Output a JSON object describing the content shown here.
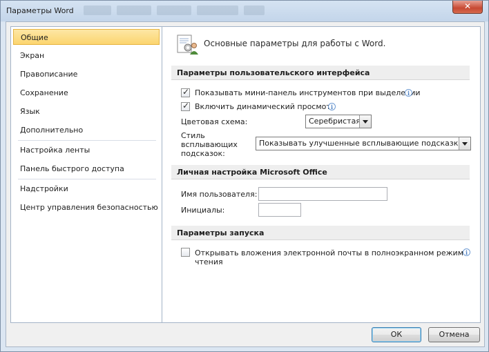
{
  "window": {
    "title": "Параметры Word",
    "close_label": "✕"
  },
  "sidebar": {
    "items": [
      {
        "label": "Общие"
      },
      {
        "label": "Экран"
      },
      {
        "label": "Правописание"
      },
      {
        "label": "Сохранение"
      },
      {
        "label": "Язык"
      },
      {
        "label": "Дополнительно"
      },
      {
        "label": "Настройка ленты"
      },
      {
        "label": "Панель быстрого доступа"
      },
      {
        "label": "Надстройки"
      },
      {
        "label": "Центр управления безопасностью"
      }
    ],
    "selected_index": 0
  },
  "content": {
    "header": "Основные параметры для работы с Word.",
    "ui_section": {
      "title": "Параметры пользовательского интерфейса",
      "mini_toolbar_label": "Показывать мини-панель инструментов при выделении",
      "mini_toolbar_checked": true,
      "live_preview_label": "Включить динамический просмотр",
      "live_preview_checked": true,
      "color_scheme_label": "Цветовая схема:",
      "color_scheme_value": "Серебристая",
      "tooltip_style_label_1": "Стиль",
      "tooltip_style_label_2": "всплывающих",
      "tooltip_style_label_3": "подсказок:",
      "tooltip_style_value": "Показывать улучшенные всплывающие подсказки"
    },
    "personal_section": {
      "title": "Личная настройка Microsoft Office",
      "username_label": "Имя пользователя:",
      "username_value": "",
      "initials_label": "Инициалы:",
      "initials_value": ""
    },
    "startup_section": {
      "title": "Параметры запуска",
      "open_attachments_label_1": "Открывать вложения электронной почты в полноэкранном режиме",
      "open_attachments_label_2": "чтения",
      "open_attachments_checked": false
    }
  },
  "buttons": {
    "ok": "ОК",
    "cancel": "Отмена"
  },
  "colors": {
    "selection_fill": "#fcd56f",
    "selection_border": "#e5b341",
    "close_button": "#c74a33"
  }
}
